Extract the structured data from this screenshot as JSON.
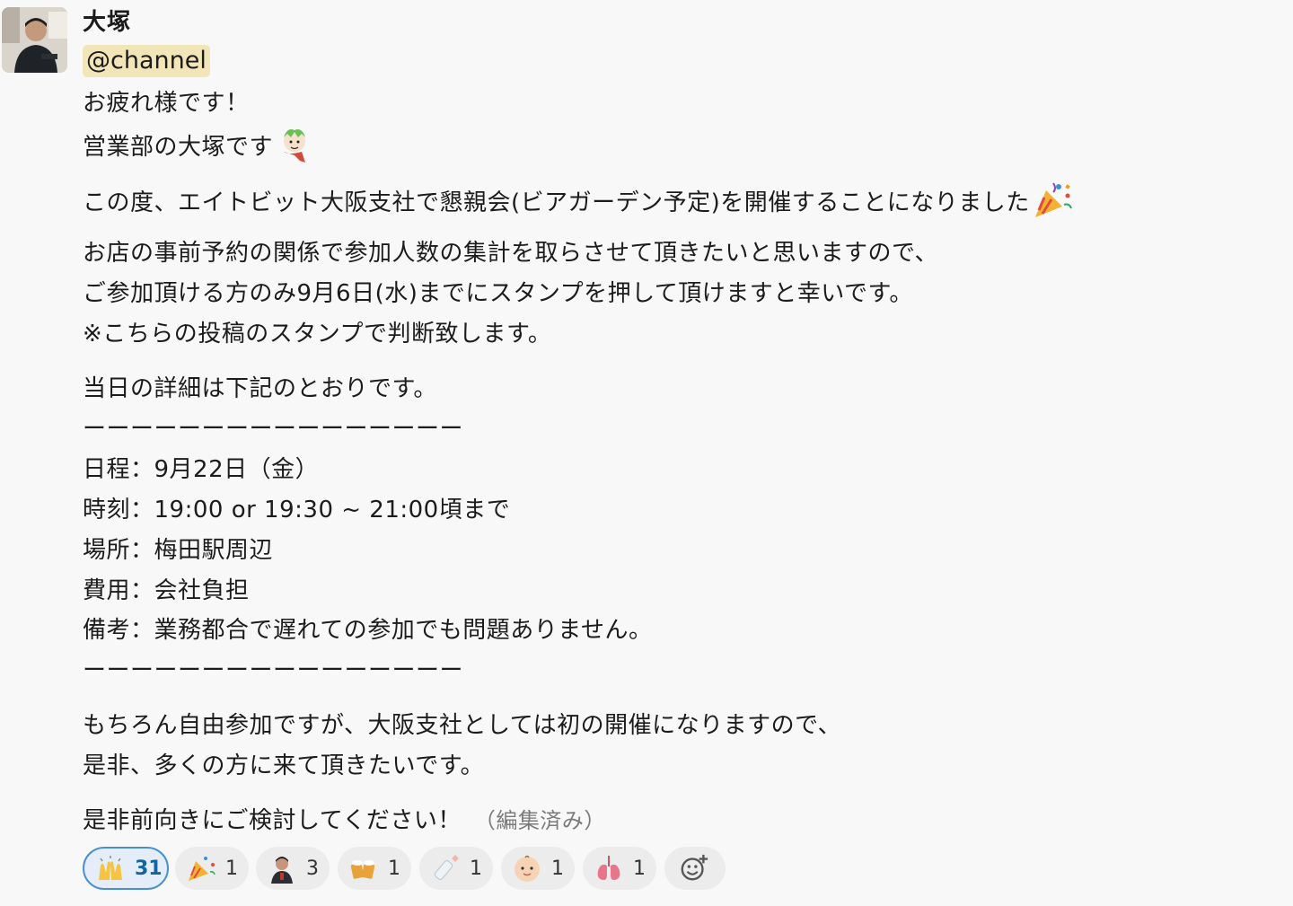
{
  "message": {
    "sender": "大塚",
    "mention": "@channel",
    "lines": [
      "お疲れ様です！",
      "営業部の大塚です",
      "この度、エイトビット大阪支社で懇親会(ビアガーデン予定)を開催することになりました",
      "お店の事前予約の関係で参加人数の集計を取らさせて頂きたいと思いますので、",
      "ご参加頂ける方のみ9月6日(水)までにスタンプを押して頂けますと幸いです。",
      "※こちらの投稿のスタンプで判断致します。",
      "当日の詳細は下記のとおりです。",
      "ーーーーーーーーーーーーーーーー",
      "日程：9月22日（金）",
      "時刻：19:00 or 19:30 ~ 21:00頃まで",
      "場所：梅田駅周辺",
      "費用：会社負担",
      "備考：業務都合で遅れての参加でも問題ありません。",
      "ーーーーーーーーーーーーーーーー",
      "もちろん自由参加ですが、大阪支社としては初の開催になりますので、",
      "是非、多くの方に来て頂きたいです。",
      "是非前向きにご検討してください！"
    ],
    "edited_label": "（編集済み）"
  },
  "reactions": [
    {
      "icon": "raised-hands-icon",
      "count": "31",
      "active": true
    },
    {
      "icon": "party-popper-icon",
      "count": "1"
    },
    {
      "icon": "person-avatar-icon",
      "count": "3"
    },
    {
      "icon": "beer-mugs-icon",
      "count": "1"
    },
    {
      "icon": "baby-bottle-icon",
      "count": "1"
    },
    {
      "icon": "baby-face-icon",
      "count": "1"
    },
    {
      "icon": "lungs-icon",
      "count": "1"
    }
  ],
  "colors": {
    "background": "#f8f8f8",
    "mention_bg": "#f2e5b8",
    "active_reaction_border": "#4a90d0"
  }
}
